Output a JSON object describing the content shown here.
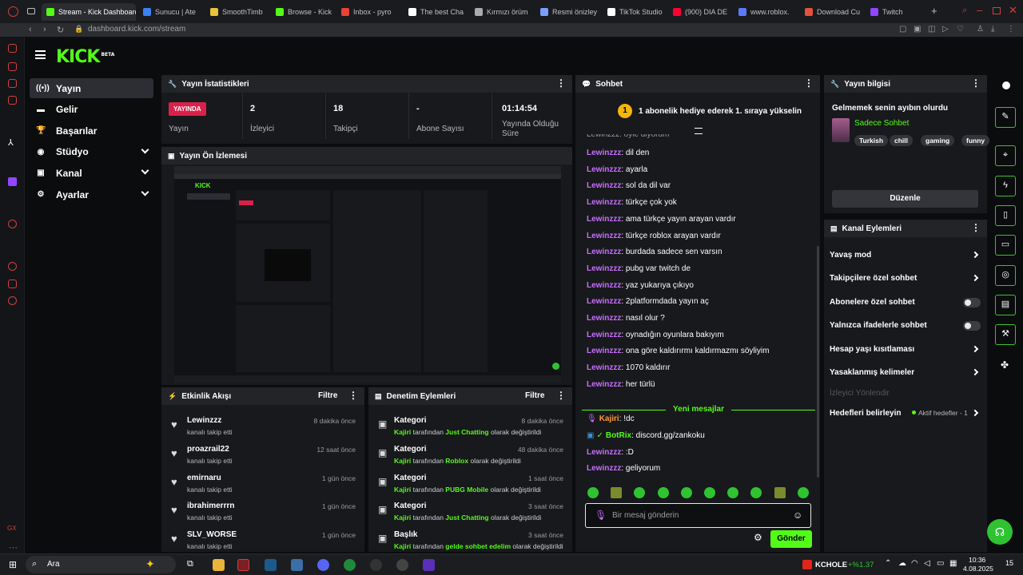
{
  "browser": {
    "tabs": [
      {
        "label": "Stream - Kick Dashboard",
        "color": "#53fc18",
        "active": true
      },
      {
        "label": "Sunucu | Ate",
        "color": "#3b82f6"
      },
      {
        "label": "SmoothTimb",
        "color": "#e9c33a"
      },
      {
        "label": "Browse - Kick",
        "color": "#53fc18"
      },
      {
        "label": "Inbox - pyro",
        "color": "#ea4335"
      },
      {
        "label": "The best Cha",
        "color": "#ffffff"
      },
      {
        "label": "Kırmızı örüm",
        "color": "#aaaaaa"
      },
      {
        "label": "Resmi önizley",
        "color": "#7aa0ff"
      },
      {
        "label": "TikTok Studio",
        "color": "#ffffff"
      },
      {
        "label": "(900) DIA DE",
        "color": "#ff0033"
      },
      {
        "label": "www.roblox.",
        "color": "#5b7bff"
      },
      {
        "label": "Download Cu",
        "color": "#e2533b"
      },
      {
        "label": "Twitch",
        "color": "#9146ff"
      }
    ],
    "url": "dashboard.kick.com/stream"
  },
  "nav": {
    "logo": "KICK",
    "logo_sup": "BETA",
    "items": [
      {
        "label": "Yayın",
        "icon": "broadcast-icon",
        "glyph": "((•))",
        "active": true
      },
      {
        "label": "Gelir",
        "icon": "wallet-icon",
        "glyph": "▬"
      },
      {
        "label": "Başarılar",
        "icon": "trophy-icon",
        "glyph": "🏆"
      },
      {
        "label": "Stüdyo",
        "icon": "palette-icon",
        "glyph": "◉"
      },
      {
        "label": "Kanal",
        "icon": "channel-icon",
        "glyph": "▣"
      },
      {
        "label": "Ayarlar",
        "icon": "gear-icon",
        "glyph": "⚙"
      }
    ]
  },
  "stats": {
    "title": "Yayın İstatistikleri",
    "live_label": "YAYINDA",
    "status_label": "Yayın",
    "viewers_value": "2",
    "viewers_label": "İzleyici",
    "followers_value": "18",
    "followers_label": "Takipçi",
    "subs_value": "-",
    "subs_label": "Abone Sayısı",
    "duration_value": "01:14:54",
    "duration_label": "Yayında Olduğu Süre"
  },
  "preview": {
    "title": "Yayın Ön İzlemesi"
  },
  "activity": {
    "title": "Etkinlik Akışı",
    "filter": "Filtre",
    "rows": [
      {
        "name": "Lewinzzz",
        "sub": "kanalı takip etti",
        "time": "8 dakika önce"
      },
      {
        "name": "proazrail22",
        "sub": "kanalı takip etti",
        "time": "12 saat önce"
      },
      {
        "name": "emirnaru",
        "sub": "kanalı takip etti",
        "time": "1 gün önce"
      },
      {
        "name": "ibrahimerrrn",
        "sub": "kanalı takip etti",
        "time": "1 gün önce"
      },
      {
        "name": "SLV_WORSE",
        "sub": "kanalı takip etti",
        "time": "1 gün önce"
      }
    ]
  },
  "moderation": {
    "title": "Denetim Eylemleri",
    "filter": "Filtre",
    "rows": [
      {
        "name": "Kategori",
        "user": "Kajiri",
        "mid": "tarafından",
        "value": "Just Chatting",
        "end": "olarak değiştirildi",
        "time": "8 dakika önce"
      },
      {
        "name": "Kategori",
        "user": "Kajiri",
        "mid": "tarafından",
        "value": "Roblox",
        "end": "olarak değiştirildi",
        "time": "48 dakika önce"
      },
      {
        "name": "Kategori",
        "user": "Kajiri",
        "mid": "tarafından",
        "value": "PUBG Mobile",
        "end": "olarak değiştirildi",
        "time": "1 saat önce"
      },
      {
        "name": "Kategori",
        "user": "Kajiri",
        "mid": "tarafından",
        "value": "Just Chatting",
        "end": "olarak değiştirildi",
        "time": "3 saat önce"
      },
      {
        "name": "Başlık",
        "user": "Kajiri",
        "mid": "tarafından",
        "value": "gelde sohbet edelim",
        "end": "olarak değiştirildi",
        "time": "3 saat önce"
      }
    ]
  },
  "chat": {
    "title": "Sohbet",
    "banner": "1 abonelik hediye ederek 1. sıraya yükselin",
    "banner_rank": "1",
    "partial_top": "Lewinzzz: öyle diyorum",
    "messages": [
      {
        "user": "Lewinzzz",
        "text": ": dil den"
      },
      {
        "user": "Lewinzzz",
        "text": ": ayarla"
      },
      {
        "user": "Lewinzzz",
        "text": ": sol da dil var"
      },
      {
        "user": "Lewinzzz",
        "text": ": türkçe çok yok"
      },
      {
        "user": "Lewinzzz",
        "text": ": ama türkçe yayın arayan vardır"
      },
      {
        "user": "Lewinzzz",
        "text": ": türkçe roblox arayan vardır"
      },
      {
        "user": "Lewinzzz",
        "text": ": burdada sadece sen varsın"
      },
      {
        "user": "Lewinzzz",
        "text": ": pubg var twitch de"
      },
      {
        "user": "Lewinzzz",
        "text": ": yaz yukarıya çıkıyo"
      },
      {
        "user": "Lewinzzz",
        "text": ": 2platformdada yayın aç"
      },
      {
        "user": "Lewinzzz",
        "text": ": nasıl olur ?"
      },
      {
        "user": "Lewinzzz",
        "text": ": oynadığın oyunlara bakıyım"
      },
      {
        "user": "Lewinzzz",
        "text": ": ona göre kaldırırmı kaldırmazmı söyliyim"
      },
      {
        "user": "Lewinzzz",
        "text": ": 1070 kaldırır"
      },
      {
        "user": "Lewinzzz",
        "text": ": her türlü"
      }
    ],
    "new_messages": "Yeni mesajlar",
    "after": [
      {
        "user": "Kajiri",
        "text": ": !dc",
        "color": "#ff9a3c"
      },
      {
        "user": "BotRix",
        "text": ": discord.gg/zankoku",
        "color": "#53fc18"
      },
      {
        "user": "Lewinzzz",
        "text": ": :D",
        "color": "#c76eff"
      },
      {
        "user": "Lewinzzz",
        "text": ": geliyorum",
        "color": "#c76eff"
      }
    ],
    "placeholder": "Bir mesaj gönderin",
    "send": "Gönder"
  },
  "info": {
    "title": "Yayın bilgisi",
    "stream_title": "Gelmemek senin ayıbın olurdu",
    "category": "Sadece Sohbet",
    "tags": [
      "Turkish",
      "chill",
      "gaming",
      "funny"
    ],
    "edit": "Düzenle"
  },
  "actions": {
    "title": "Kanal Eylemleri",
    "items": [
      {
        "label": "Yavaş mod",
        "kind": "chevron"
      },
      {
        "label": "Takipçilere özel sohbet",
        "kind": "chevron"
      },
      {
        "label": "Abonelere özel sohbet",
        "kind": "toggle"
      },
      {
        "label": "Yalnızca ifadelerle sohbet",
        "kind": "toggle"
      },
      {
        "label": "Hesap yaşı kısıtlaması",
        "kind": "chevron"
      },
      {
        "label": "Yasaklanmış kelimeler",
        "kind": "chevron"
      }
    ],
    "disabled": "İzleyici Yönlendir",
    "goals": "Hedefleri belirleyin",
    "goals_badge": "Aktif hedefler - 1"
  },
  "taskbar": {
    "search": "Ara",
    "stock": "KCHOLE",
    "stock_change": "+%1.37",
    "time": "10:36",
    "date": "4.08.2025",
    "notif": "15"
  }
}
